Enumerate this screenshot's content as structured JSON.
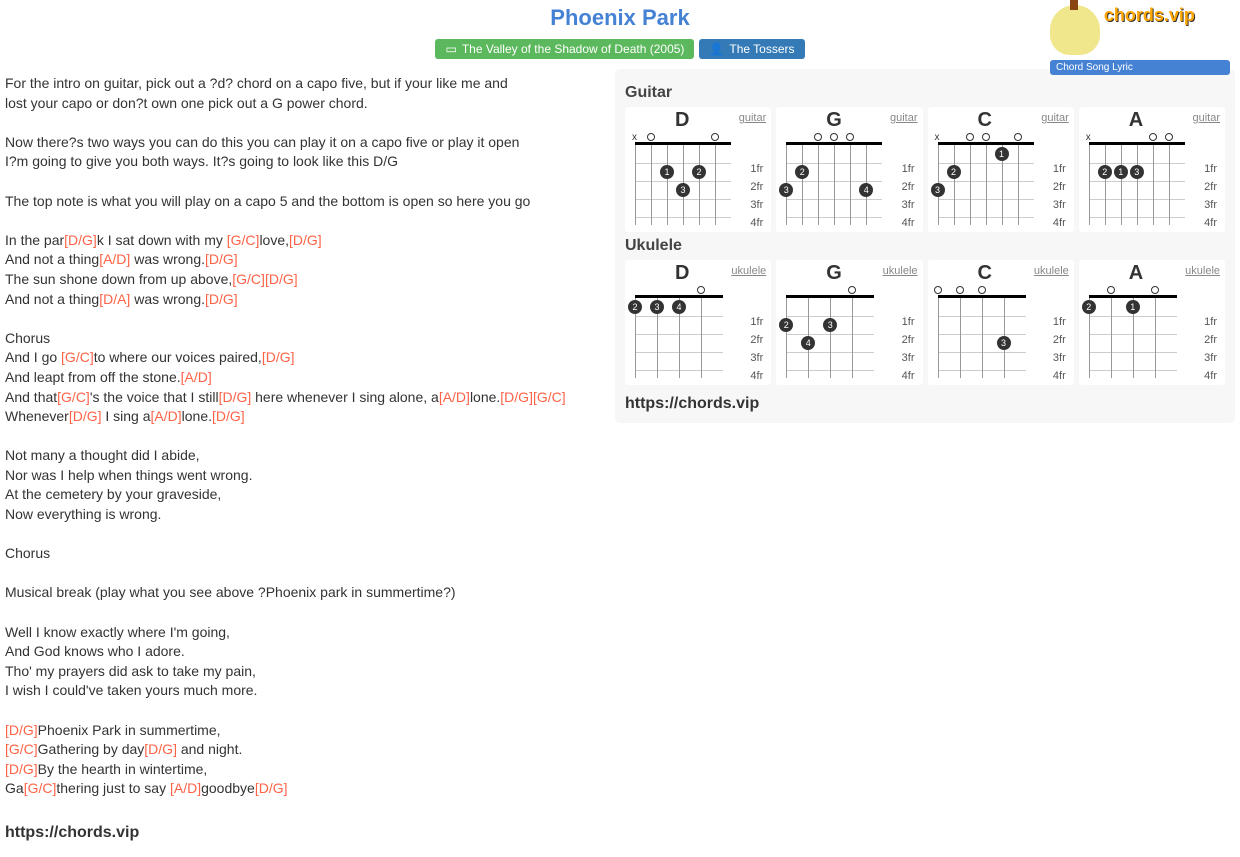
{
  "title": "Phoenix Park",
  "album": "The Valley of the Shadow of Death (2005)",
  "artist": "The Tossers",
  "logo_brand": "chords.vip",
  "logo_tagline": "Chord Song Lyric",
  "sections": {
    "guitar": "Guitar",
    "ukulele": "Ukulele"
  },
  "frets": [
    "1fr",
    "2fr",
    "3fr",
    "4fr"
  ],
  "guitar_chords": [
    {
      "name": "D",
      "type": "guitar"
    },
    {
      "name": "G",
      "type": "guitar"
    },
    {
      "name": "C",
      "type": "guitar"
    },
    {
      "name": "A",
      "type": "guitar"
    }
  ],
  "ukulele_chords": [
    {
      "name": "D",
      "type": "ukulele"
    },
    {
      "name": "G",
      "type": "ukulele"
    },
    {
      "name": "C",
      "type": "ukulele"
    },
    {
      "name": "A",
      "type": "ukulele"
    }
  ],
  "url": "https://chords.vip",
  "lyrics": [
    {
      "t": "For the intro on guitar, pick out a ?d? chord on a capo five, but if your like me and"
    },
    {
      "t": "lost your capo or don?t own one pick out a G power chord."
    },
    {
      "t": ""
    },
    {
      "t": "Now there?s two ways you can do this you can play it on a capo five or play it open"
    },
    {
      "t": "I?m going to give you both ways. It?s going to look like this D/G"
    },
    {
      "t": ""
    },
    {
      "t": "The top note is what you will play on a capo 5 and the bottom is open so here you go"
    },
    {
      "t": ""
    },
    {
      "parts": [
        {
          "t": "In the par"
        },
        {
          "c": "[D/G]"
        },
        {
          "t": "k I sat down with my "
        },
        {
          "c": "[G/C]"
        },
        {
          "t": "love,"
        },
        {
          "c": "[D/G]"
        }
      ]
    },
    {
      "parts": [
        {
          "t": "And not a thing"
        },
        {
          "c": "[A/D]"
        },
        {
          "t": " was wrong."
        },
        {
          "c": "[D/G]"
        }
      ]
    },
    {
      "parts": [
        {
          "t": "The sun shone down from up above,"
        },
        {
          "c": "[G/C]"
        },
        {
          "c": "[D/G]"
        }
      ]
    },
    {
      "parts": [
        {
          "t": "And not a thing"
        },
        {
          "c": "[D/A]"
        },
        {
          "t": " was wrong."
        },
        {
          "c": "[D/G]"
        }
      ]
    },
    {
      "t": ""
    },
    {
      "t": "Chorus"
    },
    {
      "parts": [
        {
          "t": "And I go "
        },
        {
          "c": "[G/C]"
        },
        {
          "t": "to where our voices paired,"
        },
        {
          "c": "[D/G]"
        }
      ]
    },
    {
      "parts": [
        {
          "t": "And leapt from off the stone."
        },
        {
          "c": "[A/D]"
        }
      ]
    },
    {
      "parts": [
        {
          "t": "And that"
        },
        {
          "c": "[G/C]"
        },
        {
          "t": "'s the voice that I still"
        },
        {
          "c": "[D/G]"
        },
        {
          "t": " here whenever I sing alone, a"
        },
        {
          "c": "[A/D]"
        },
        {
          "t": "lone."
        },
        {
          "c": "[D/G]"
        },
        {
          "c": "[G/C]"
        }
      ]
    },
    {
      "parts": [
        {
          "t": "Whenever"
        },
        {
          "c": "[D/G]"
        },
        {
          "t": " I sing a"
        },
        {
          "c": "[A/D]"
        },
        {
          "t": "lone."
        },
        {
          "c": "[D/G]"
        }
      ]
    },
    {
      "t": ""
    },
    {
      "t": "Not many a thought did I abide,"
    },
    {
      "t": "Nor was I help when things went wrong."
    },
    {
      "t": "At the cemetery by your graveside,"
    },
    {
      "t": "Now everything is wrong."
    },
    {
      "t": ""
    },
    {
      "t": "Chorus"
    },
    {
      "t": ""
    },
    {
      "t": "Musical break (play what you see above ?Phoenix park in summertime?)"
    },
    {
      "t": ""
    },
    {
      "t": "Well I know exactly where I'm going,"
    },
    {
      "t": "And God knows who I adore."
    },
    {
      "t": "Tho' my prayers did ask to take my pain,"
    },
    {
      "t": "I wish I could've taken yours much more."
    },
    {
      "t": ""
    },
    {
      "parts": [
        {
          "c": "[D/G]"
        },
        {
          "t": "Phoenix Park in summertime,"
        }
      ]
    },
    {
      "parts": [
        {
          "c": "[G/C]"
        },
        {
          "t": "Gathering by day"
        },
        {
          "c": "[D/G]"
        },
        {
          "t": " and night."
        }
      ]
    },
    {
      "parts": [
        {
          "c": "[D/G]"
        },
        {
          "t": "By the hearth in wintertime,"
        }
      ]
    },
    {
      "parts": [
        {
          "t": "Ga"
        },
        {
          "c": "[G/C]"
        },
        {
          "t": "thering just to say "
        },
        {
          "c": "[A/D]"
        },
        {
          "t": "goodbye"
        },
        {
          "c": "[D/G]"
        }
      ]
    }
  ]
}
